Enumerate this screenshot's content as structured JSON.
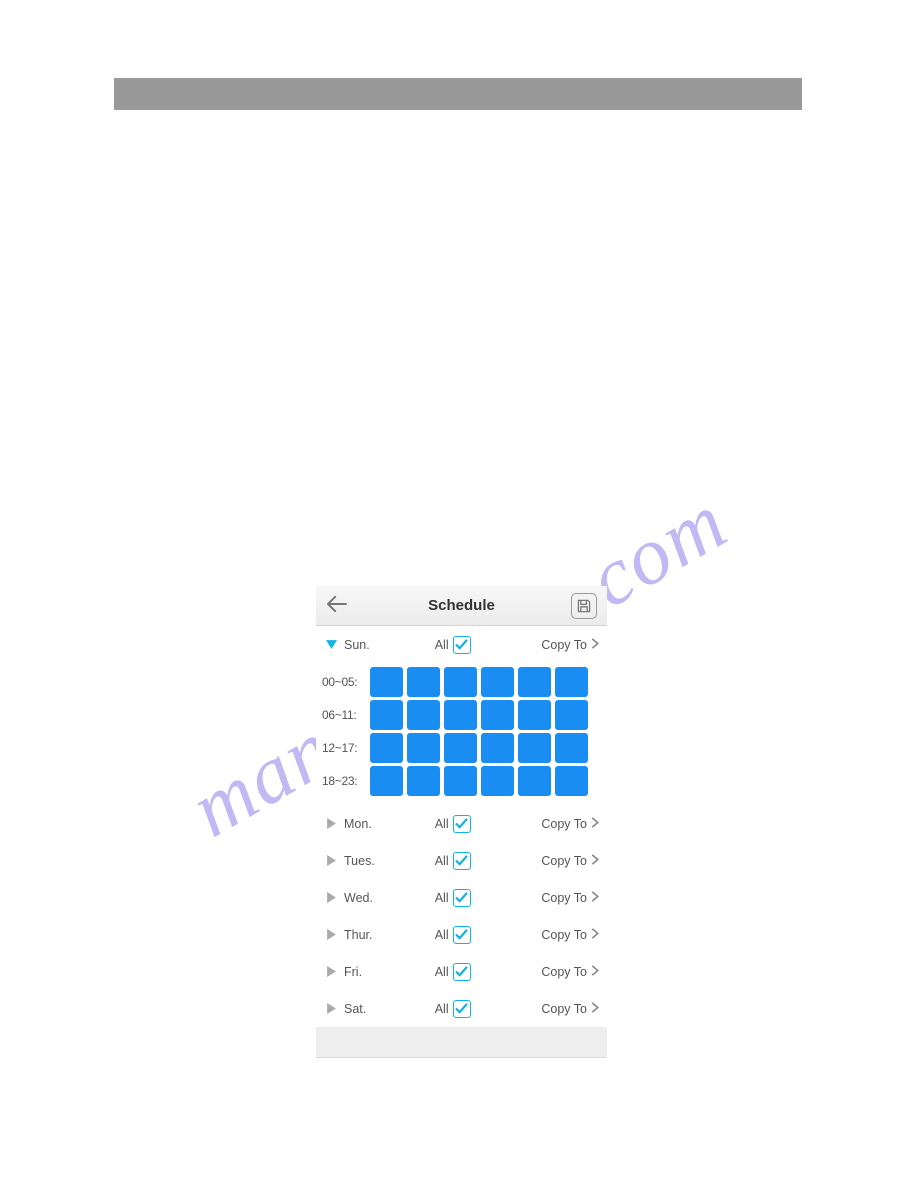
{
  "screen_title": "Schedule",
  "colors": {
    "accent": "#11b2e6",
    "cell": "#1a8df2"
  },
  "grid_row_labels": [
    "00~05:",
    "06~11:",
    "12~17:",
    "18~23:"
  ],
  "days": [
    {
      "name": "Sun.",
      "expanded": true,
      "all_label": "All",
      "all_checked": true,
      "copy_label": "Copy To"
    },
    {
      "name": "Mon.",
      "expanded": false,
      "all_label": "All",
      "all_checked": true,
      "copy_label": "Copy To"
    },
    {
      "name": "Tues.",
      "expanded": false,
      "all_label": "All",
      "all_checked": true,
      "copy_label": "Copy To"
    },
    {
      "name": "Wed.",
      "expanded": false,
      "all_label": "All",
      "all_checked": true,
      "copy_label": "Copy To"
    },
    {
      "name": "Thur.",
      "expanded": false,
      "all_label": "All",
      "all_checked": true,
      "copy_label": "Copy To"
    },
    {
      "name": "Fri.",
      "expanded": false,
      "all_label": "All",
      "all_checked": true,
      "copy_label": "Copy To"
    },
    {
      "name": "Sat.",
      "expanded": false,
      "all_label": "All",
      "all_checked": true,
      "copy_label": "Copy To"
    }
  ],
  "watermark_text": "manualshive.com"
}
